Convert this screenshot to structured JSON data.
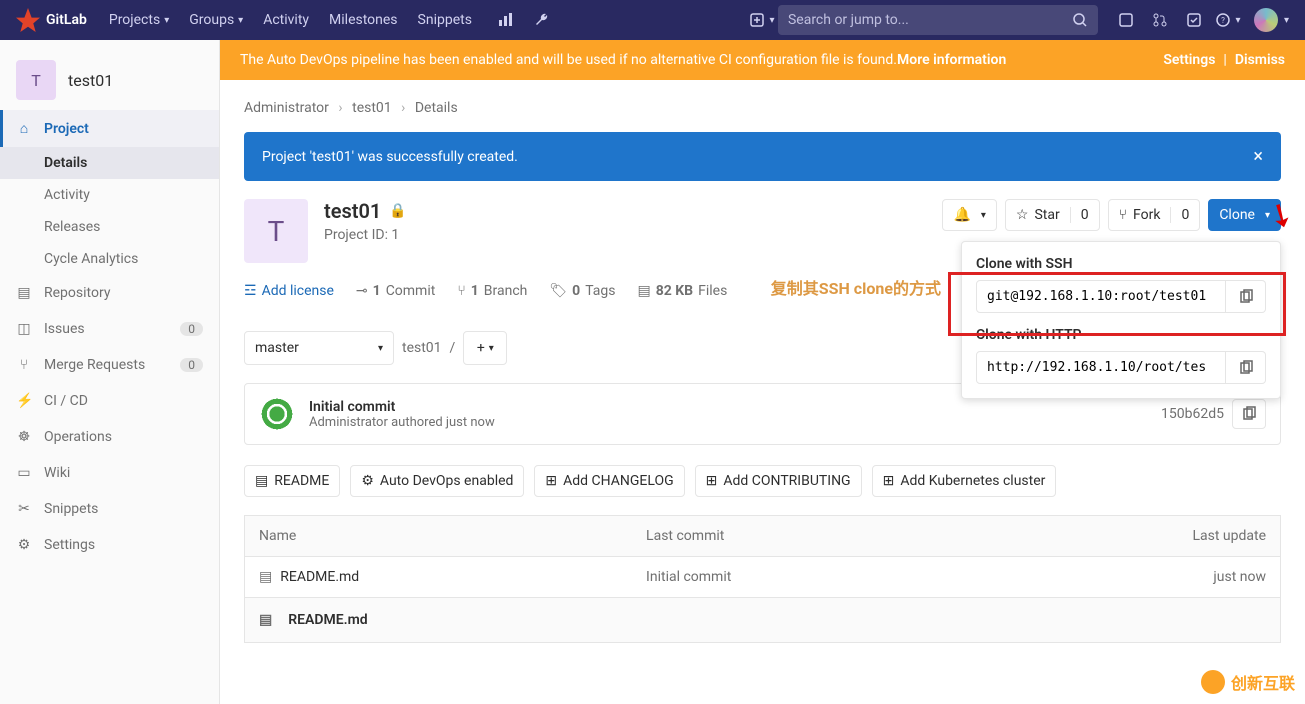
{
  "topbar": {
    "brand": "GitLab",
    "nav": [
      "Projects",
      "Groups",
      "Activity",
      "Milestones",
      "Snippets"
    ],
    "search_placeholder": "Search or jump to..."
  },
  "sidebar": {
    "project_initial": "T",
    "project_name": "test01",
    "items": [
      {
        "icon": "home",
        "label": "Project",
        "active": true,
        "subs": [
          {
            "label": "Details",
            "active": true
          },
          {
            "label": "Activity"
          },
          {
            "label": "Releases"
          },
          {
            "label": "Cycle Analytics"
          }
        ]
      },
      {
        "icon": "repo",
        "label": "Repository"
      },
      {
        "icon": "issues",
        "label": "Issues",
        "badge": "0"
      },
      {
        "icon": "mr",
        "label": "Merge Requests",
        "badge": "0"
      },
      {
        "icon": "ci",
        "label": "CI / CD"
      },
      {
        "icon": "ops",
        "label": "Operations"
      },
      {
        "icon": "wiki",
        "label": "Wiki"
      },
      {
        "icon": "snip",
        "label": "Snippets"
      },
      {
        "icon": "gear",
        "label": "Settings"
      }
    ]
  },
  "banner": {
    "text": "The Auto DevOps pipeline has been enabled and will be used if no alternative CI configuration file is found. ",
    "more": "More information",
    "settings": "Settings",
    "dismiss": "Dismiss"
  },
  "breadcrumb": [
    "Administrator",
    "test01",
    "Details"
  ],
  "alert": "Project 'test01' was successfully created.",
  "project": {
    "name": "test01",
    "id_label": "Project ID: 1",
    "star": "Star",
    "star_count": "0",
    "fork": "Fork",
    "fork_count": "0",
    "clone": "Clone"
  },
  "clone_panel": {
    "ssh_label": "Clone with SSH",
    "ssh_url": "git@192.168.1.10:root/test01",
    "http_label": "Clone with HTTP",
    "http_url": "http://192.168.1.10/root/tes"
  },
  "stats": {
    "license": "Add license",
    "commits_n": "1",
    "commits": "Commit",
    "branches_n": "1",
    "branches": "Branch",
    "tags_n": "0",
    "tags": "Tags",
    "size": "82 KB",
    "files": "Files"
  },
  "branch": {
    "selected": "master",
    "path": "test01",
    "sep": "/"
  },
  "commit": {
    "title": "Initial commit",
    "author": "Administrator",
    "when": "authored just now",
    "sha": "150b62d5"
  },
  "buttons_row": [
    "README",
    "Auto DevOps enabled",
    "Add CHANGELOG",
    "Add CONTRIBUTING",
    "Add Kubernetes cluster"
  ],
  "table": {
    "headers": [
      "Name",
      "Last commit",
      "Last update"
    ],
    "rows": [
      {
        "name": "README.md",
        "commit": "Initial commit",
        "update": "just now"
      }
    ]
  },
  "readme_file": "README.md",
  "annotation": "复制其SSH clone的方式",
  "watermark": "创新互联"
}
